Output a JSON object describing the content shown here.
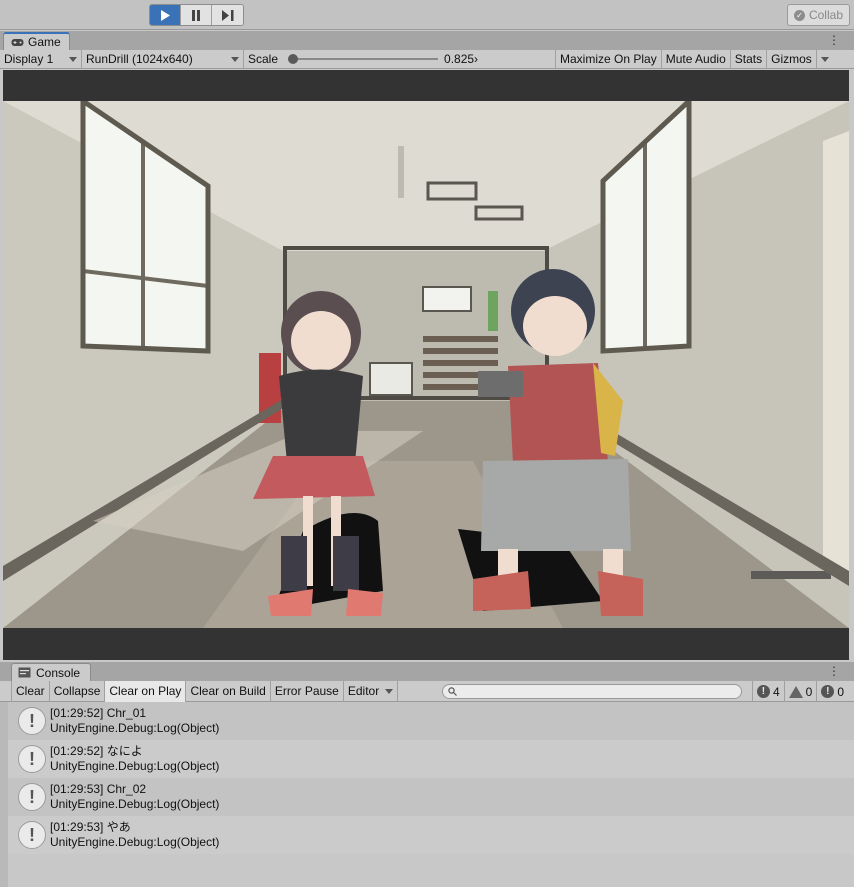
{
  "toolbar": {
    "play_icon": "play-icon",
    "pause_icon": "pause-icon",
    "step_icon": "step-icon",
    "collab_label": "Collab",
    "accent": "#3a72b8"
  },
  "game": {
    "tab_label": "Game",
    "display": "Display 1",
    "resolution": "RunDrill (1024x640)",
    "scale_label": "Scale",
    "scale_value": "0.825›",
    "maximize": "Maximize On Play",
    "mute": "Mute Audio",
    "stats": "Stats",
    "gizmos": "Gizmos"
  },
  "console": {
    "tab_label": "Console",
    "clear": "Clear",
    "collapse": "Collapse",
    "clear_on_play": "Clear on Play",
    "clear_on_build": "Clear on Build",
    "error_pause": "Error Pause",
    "editor": "Editor",
    "search_placeholder": "",
    "log_count": "4",
    "warn_count": "0",
    "error_count": "0",
    "entries": [
      {
        "line1": "[01:29:52] Chr_01",
        "line2": "UnityEngine.Debug:Log(Object)"
      },
      {
        "line1": "[01:29:52] なによ",
        "line2": "UnityEngine.Debug:Log(Object)"
      },
      {
        "line1": "[01:29:53] Chr_02",
        "line2": "UnityEngine.Debug:Log(Object)"
      },
      {
        "line1": "[01:29:53] やあ",
        "line2": "UnityEngine.Debug:Log(Object)"
      }
    ]
  }
}
